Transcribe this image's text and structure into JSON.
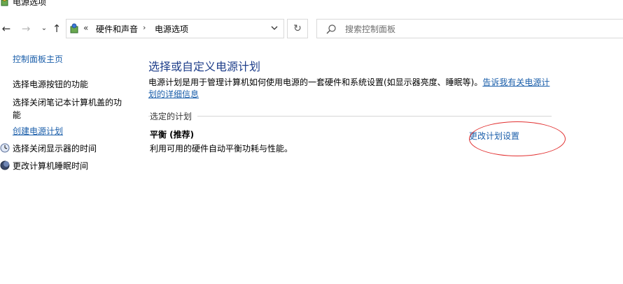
{
  "window": {
    "title": "电源选项"
  },
  "nav": {
    "back": "←",
    "forward": "→",
    "recent": "⌄",
    "up": "↑"
  },
  "address": {
    "root_sep": "«",
    "crumb1": "硬件和声音",
    "arrow": "›",
    "crumb2": "电源选项"
  },
  "refresh": "↻",
  "search": {
    "placeholder": "搜索控制面板"
  },
  "sidebar": {
    "items": [
      {
        "label": "控制面板主页"
      },
      {
        "label": "选择电源按钮的功能"
      },
      {
        "label": "选择关闭笔记本计算机盖的功能"
      },
      {
        "label": "创建电源计划"
      },
      {
        "label": "选择关闭显示器的时间"
      },
      {
        "label": "更改计算机睡眠时间"
      }
    ]
  },
  "main": {
    "title": "选择或自定义电源计划",
    "description": "电源计划是用于管理计算机如何使用电源的一套硬件和系统设置(如显示器亮度、睡眠等)。",
    "description_link": "告诉我有关电源计划的详细信息",
    "section_label": "选定的计划",
    "plan": {
      "name": "平衡 (推荐)",
      "description": "利用可用的硬件自动平衡功耗与性能。",
      "change_link": "更改计划设置"
    }
  },
  "colors": {
    "link": "#1a5eaa",
    "title": "#1e3e8a",
    "annotation": "#e23030"
  },
  "icons": [
    "power-options-icon",
    "search-icon",
    "monitor-icon",
    "sleep-icon"
  ]
}
